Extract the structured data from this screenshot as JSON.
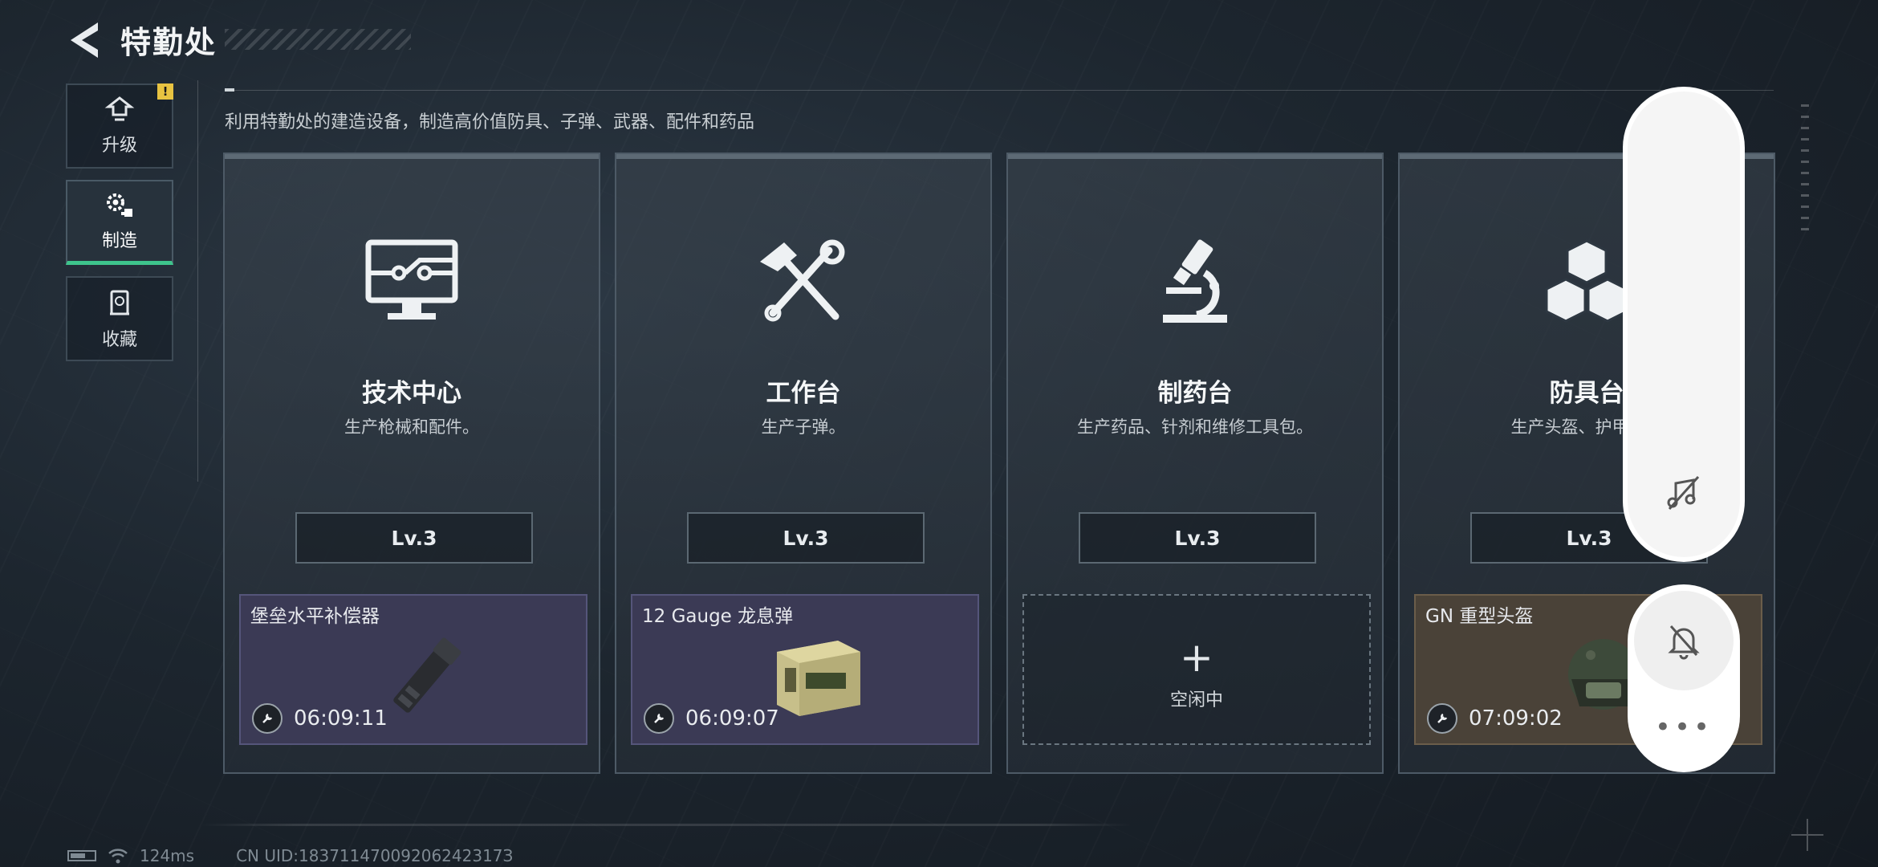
{
  "header": {
    "title": "特勤处",
    "subtitle": "利用特勤处的建造设备，制造高价值防具、子弹、武器、配件和药品"
  },
  "sidebar": {
    "items": [
      {
        "label": "升级",
        "icon": "upgrade-icon",
        "badge": "!"
      },
      {
        "label": "制造",
        "icon": "gears-icon",
        "active": true
      },
      {
        "label": "收藏",
        "icon": "collection-icon"
      }
    ]
  },
  "cards": [
    {
      "title": "技术中心",
      "desc": "生产枪械和配件。",
      "level": "Lv.3",
      "icon": "monitor-circuit-icon",
      "slot": {
        "name": "堡垒水平补偿器",
        "timer": "06:09:11",
        "style": "purple"
      }
    },
    {
      "title": "工作台",
      "desc": "生产子弹。",
      "level": "Lv.3",
      "icon": "hammer-wrench-icon",
      "slot": {
        "name": "12 Gauge 龙息弹",
        "timer": "06:09:07",
        "style": "purple"
      }
    },
    {
      "title": "制药台",
      "desc": "生产药品、针剂和维修工具包。",
      "level": "Lv.3",
      "icon": "microscope-icon",
      "slot": {
        "idle_label": "空闲中",
        "plus": "+"
      }
    },
    {
      "title": "防具台",
      "desc": "生产头盔、护甲、胸",
      "level": "Lv.3",
      "icon": "cubes-icon",
      "slot": {
        "name": "GN 重型头盔",
        "timer": "07:09:02",
        "style": "brown"
      }
    }
  ],
  "floating": {
    "more": "•••",
    "icons": [
      "music-off-icon",
      "bell-off-icon",
      "more-icon"
    ]
  },
  "status": {
    "ping": "124ms",
    "uid": "CN UID:18371147009206242317З"
  },
  "colors": {
    "accent": "#3ec48c",
    "badge": "#e8c341",
    "slot_purple": "#3b3a55",
    "slot_brown": "#4a4238"
  }
}
